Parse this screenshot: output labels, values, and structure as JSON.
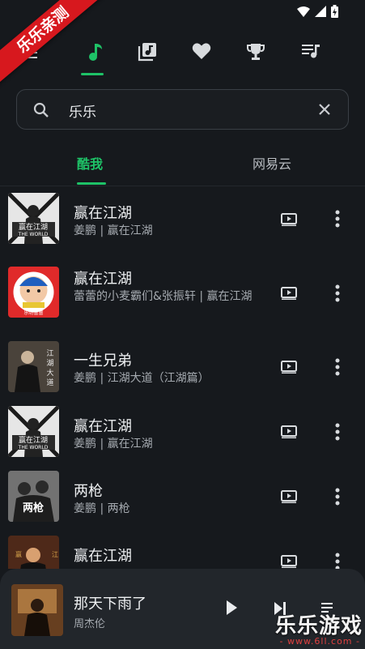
{
  "watermark": {
    "ribbon_text": "乐乐亲测",
    "logo_text": "乐乐游戏",
    "url": "- www.6ll.com -"
  },
  "nav_tabs": [
    {
      "icon": "music-note-icon",
      "active": true
    },
    {
      "icon": "album-library-icon",
      "active": false
    },
    {
      "icon": "heart-icon",
      "active": false
    },
    {
      "icon": "trophy-icon",
      "active": false
    },
    {
      "icon": "playlist-icon",
      "active": false
    }
  ],
  "search": {
    "value": "乐乐",
    "placeholder": ""
  },
  "source_tabs": [
    {
      "label": "酷我",
      "active": true
    },
    {
      "label": "网易云",
      "active": false
    }
  ],
  "songs": [
    {
      "title": "赢在江湖",
      "subtitle": "姜鹏 | 赢在江湖"
    },
    {
      "title": "赢在江湖",
      "subtitle": "蕾蕾的小麦霸们&张振轩 | 赢在江湖"
    },
    {
      "title": "一生兄弟",
      "subtitle": "姜鹏 | 江湖大道（江湖篇）"
    },
    {
      "title": "赢在江湖",
      "subtitle": "姜鹏 | 赢在江湖"
    },
    {
      "title": "两枪",
      "subtitle": "姜鹏 | 两枪"
    },
    {
      "title": "赢在江湖",
      "subtitle": ""
    }
  ],
  "now_playing": {
    "title": "那天下雨了",
    "artist": "周杰伦"
  },
  "colors": {
    "accent": "#1ec267",
    "background": "#16191d",
    "player_background": "#22262b"
  }
}
